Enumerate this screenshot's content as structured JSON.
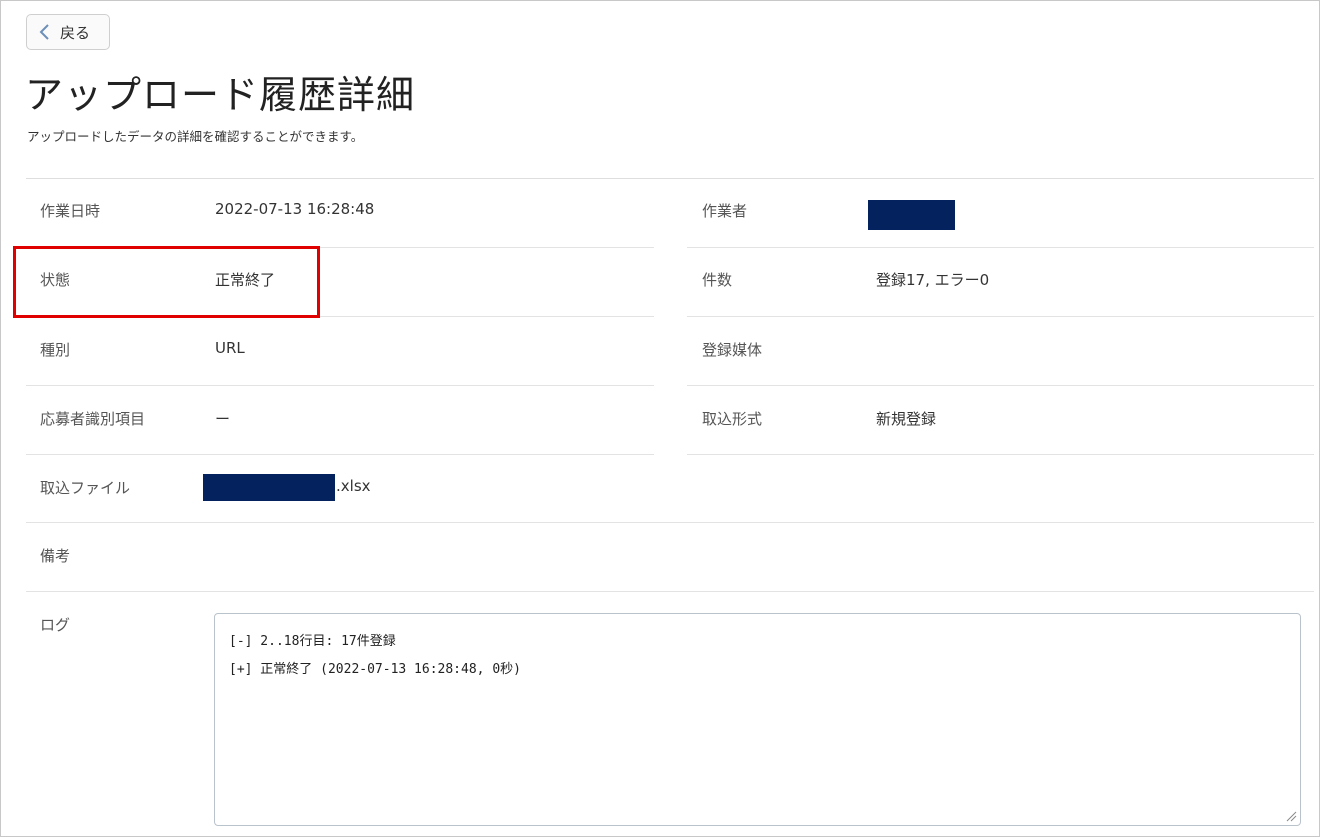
{
  "header": {
    "back_label": "戻る",
    "title": "アップロード履歴詳細",
    "description": "アップロードしたデータの詳細を確認することができます。"
  },
  "details": {
    "work_datetime": {
      "label": "作業日時",
      "value": "2022-07-13 16:28:48"
    },
    "worker": {
      "label": "作業者",
      "value": ""
    },
    "status": {
      "label": "状態",
      "value": "正常終了"
    },
    "count": {
      "label": "件数",
      "value": "登録17, エラー0"
    },
    "type": {
      "label": "種別",
      "value": "URL"
    },
    "media": {
      "label": "登録媒体",
      "value": ""
    },
    "applicant_id_item": {
      "label": "応募者識別項目",
      "value": "ー"
    },
    "import_format": {
      "label": "取込形式",
      "value": "新規登録"
    },
    "import_file": {
      "label": "取込ファイル",
      "value": ".xlsx"
    },
    "remarks": {
      "label": "備考",
      "value": ""
    },
    "log": {
      "label": "ログ",
      "lines": [
        "[-] 2..18行目: 17件登録",
        "[+] 正常終了 (2022-07-13 16:28:48, 0秒)"
      ]
    }
  },
  "colors": {
    "redaction": "#04225e",
    "highlight": "#e00000"
  }
}
